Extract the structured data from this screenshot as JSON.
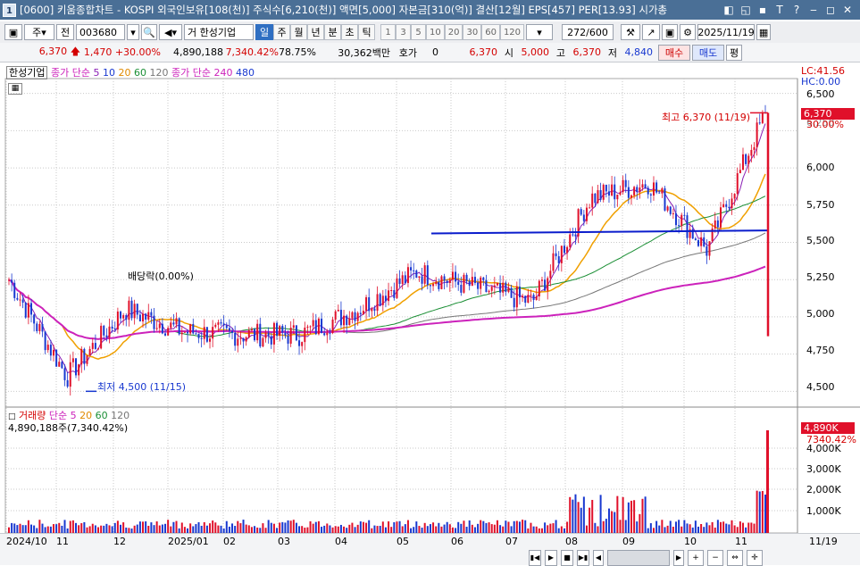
{
  "window": {
    "num": "1",
    "title": "[0600] 키움종합차트 - KOSPI 외국인보유[108(천)] 주식수[6,210(천)] 액면[5,000] 자본금[310(억)] 결산[12월] EPS[457] PER[13.93] 시가총",
    "buttons": [
      "◧",
      "◱",
      "▪",
      "T",
      "?",
      "‒",
      "◻",
      "✕"
    ]
  },
  "toolbar1": {
    "market": "주",
    "all_label": "전",
    "code": "003680",
    "stock_name": "한성기업",
    "prefix": "거",
    "periods": [
      "일",
      "주",
      "월",
      "년",
      "분",
      "초",
      "틱"
    ],
    "active_period": "일",
    "steps": [
      "1",
      "3",
      "5",
      "10",
      "20",
      "30",
      "60",
      "120"
    ],
    "count": "272",
    "total": "/600",
    "date": "2025/11/19"
  },
  "quote": {
    "price": "6,370",
    "change": "1,470",
    "change_pct": "+30.00%",
    "volume": "4,890,188",
    "vol_ratio": "7,340.42%",
    "turnover": "78.75%",
    "amount": "30,362백만",
    "hoga_label": "호가",
    "hoga_value": "0",
    "cur": "6,370",
    "open_label": "시",
    "open": "5,000",
    "high_label": "고",
    "high": "6,370",
    "low_label": "저",
    "low": "4,840",
    "buy": "매수",
    "sell": "매도",
    "flat": "평"
  },
  "price_legend": {
    "name": "한성기업",
    "ma_label": "종가 단순",
    "ma": [
      "5",
      "10",
      "20",
      "60",
      "120"
    ],
    "ma_long_label": "종가 단순",
    "ma_long": [
      "240",
      "480"
    ],
    "lc": "LC:41.56",
    "hc": "HC:0.00"
  },
  "price_axis": [
    "6,500",
    "6,250",
    "6,000",
    "5,750",
    "5,500",
    "5,250",
    "5,000",
    "4,750",
    "4,500"
  ],
  "last_price": {
    "value": "6,370",
    "pct": "30.00%"
  },
  "annotations": {
    "high": "최고 6,370 (11/19)",
    "low": "최저 4,500 (11/15)",
    "ex_rights": "배당락(0.00%)"
  },
  "volume_legend": {
    "name": "거래량",
    "ma_label": "단순",
    "ma": [
      "5",
      "20",
      "60",
      "120"
    ],
    "value": "4,890,188주(7,340.42%)"
  },
  "volume_axis": [
    "4,000K",
    "3,000K",
    "2,000K",
    "1,000K"
  ],
  "last_volume": {
    "value": "4,890K",
    "pct": "7340.42%"
  },
  "x_labels": [
    "2024/10",
    "11",
    "12",
    "2025/01",
    "02",
    "03",
    "04",
    "05",
    "06",
    "07",
    "08",
    "09",
    "10",
    "11",
    "11/19"
  ],
  "colors": {
    "up": "#e0102a",
    "down": "#1838d0",
    "ma5": "#8a1fb5",
    "ma10": "#1a33b8",
    "ma20": "#f0a000",
    "ma60": "#1b8f35",
    "ma120": "#777777",
    "ma240": "#cc22bb",
    "trend": "#0a1ccc"
  },
  "chart_data": {
    "type": "candlestick",
    "ylim": [
      4400,
      6600
    ],
    "x": [
      "2024/10",
      "11",
      "12",
      "2025/01",
      "02",
      "03",
      "04",
      "05",
      "06",
      "07",
      "08",
      "09",
      "10",
      "11"
    ],
    "close": [
      5250,
      4600,
      5050,
      4900,
      4880,
      4880,
      5050,
      5300,
      5200,
      5100,
      5800,
      5900,
      5450,
      6370
    ],
    "high": 6370,
    "low": 4500
  }
}
